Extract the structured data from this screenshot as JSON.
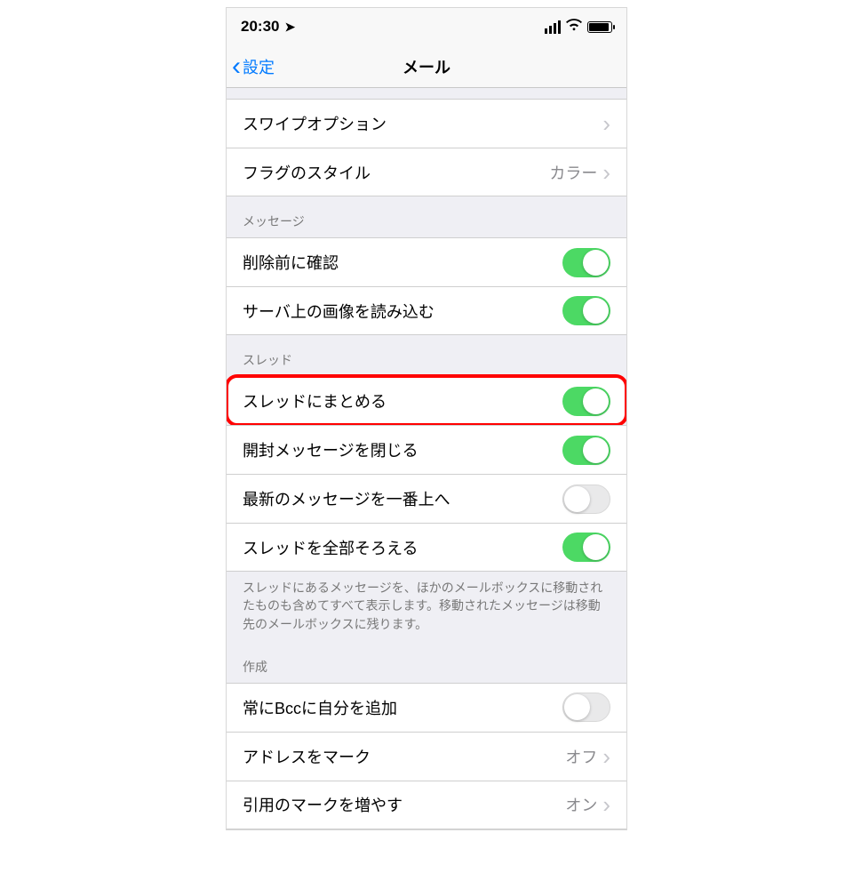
{
  "status": {
    "time": "20:30",
    "location_icon": "➤"
  },
  "nav": {
    "back_label": "設定",
    "title": "メール"
  },
  "sections": {
    "top": {
      "rows": [
        {
          "label": "スワイプオプション"
        },
        {
          "label": "フラグのスタイル",
          "detail": "カラー"
        }
      ]
    },
    "message": {
      "header": "メッセージ",
      "rows": [
        {
          "label": "削除前に確認",
          "on": true
        },
        {
          "label": "サーバ上の画像を読み込む",
          "on": true
        }
      ]
    },
    "thread": {
      "header": "スレッド",
      "rows": [
        {
          "label": "スレッドにまとめる",
          "on": true,
          "highlighted": true
        },
        {
          "label": "開封メッセージを閉じる",
          "on": true
        },
        {
          "label": "最新のメッセージを一番上へ",
          "on": false
        },
        {
          "label": "スレッドを全部そろえる",
          "on": true
        }
      ],
      "footer": "スレッドにあるメッセージを、ほかのメールボックスに移動されたものも含めてすべて表示します。移動されたメッセージは移動先のメールボックスに残ります。"
    },
    "compose": {
      "header": "作成",
      "rows": [
        {
          "label": "常にBccに自分を追加",
          "toggle": true,
          "on": false
        },
        {
          "label": "アドレスをマーク",
          "detail": "オフ"
        },
        {
          "label": "引用のマークを増やす",
          "detail": "オン"
        }
      ]
    }
  }
}
